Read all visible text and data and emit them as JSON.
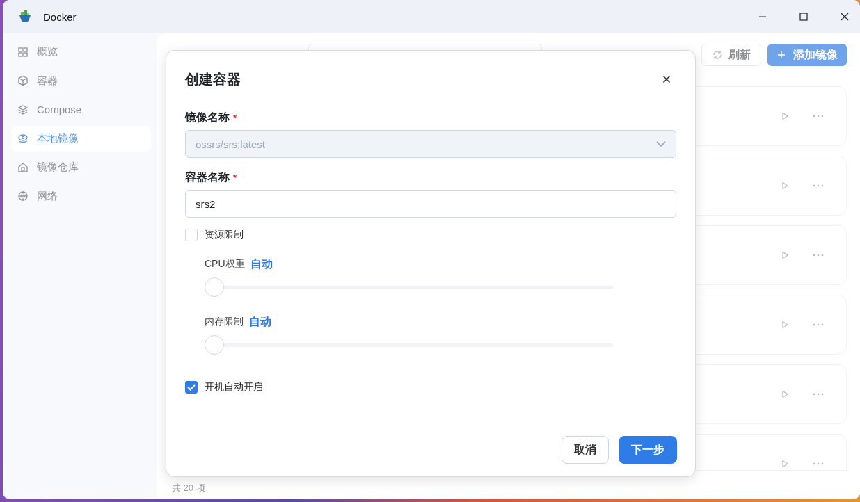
{
  "window": {
    "title": "Docker"
  },
  "sidebar": {
    "items": [
      {
        "label": "概览",
        "selected": false
      },
      {
        "label": "容器",
        "selected": false
      },
      {
        "label": "Compose",
        "selected": false
      },
      {
        "label": "本地镜像",
        "selected": true
      },
      {
        "label": "镜像仓库",
        "selected": false
      },
      {
        "label": "网络",
        "selected": false
      }
    ]
  },
  "toolbar": {
    "refresh": "刷新",
    "add": "添加镜像"
  },
  "footer": {
    "total": "共 20 项"
  },
  "dialog": {
    "title": "创建容器",
    "fields": [
      {
        "kind": "select",
        "label": "镜像名称",
        "required_mark": "*",
        "value": "ossrs/srs:latest",
        "disabled": true
      },
      {
        "kind": "text",
        "label": "容器名称",
        "required_mark": "*",
        "value": "srs2",
        "disabled": false
      }
    ],
    "resource_limit": {
      "label": "资源限制",
      "checked": false
    },
    "sliders": [
      {
        "label": "CPU权重",
        "reading": "自动",
        "level": 0
      },
      {
        "label": "内存限制",
        "reading": "自动",
        "level": 0
      }
    ],
    "autostart": {
      "label": "开机自动开启",
      "checked": true
    },
    "buttons": [
      {
        "kind": "secondary",
        "label": "取消"
      },
      {
        "kind": "primary",
        "label": "下一步"
      }
    ]
  }
}
